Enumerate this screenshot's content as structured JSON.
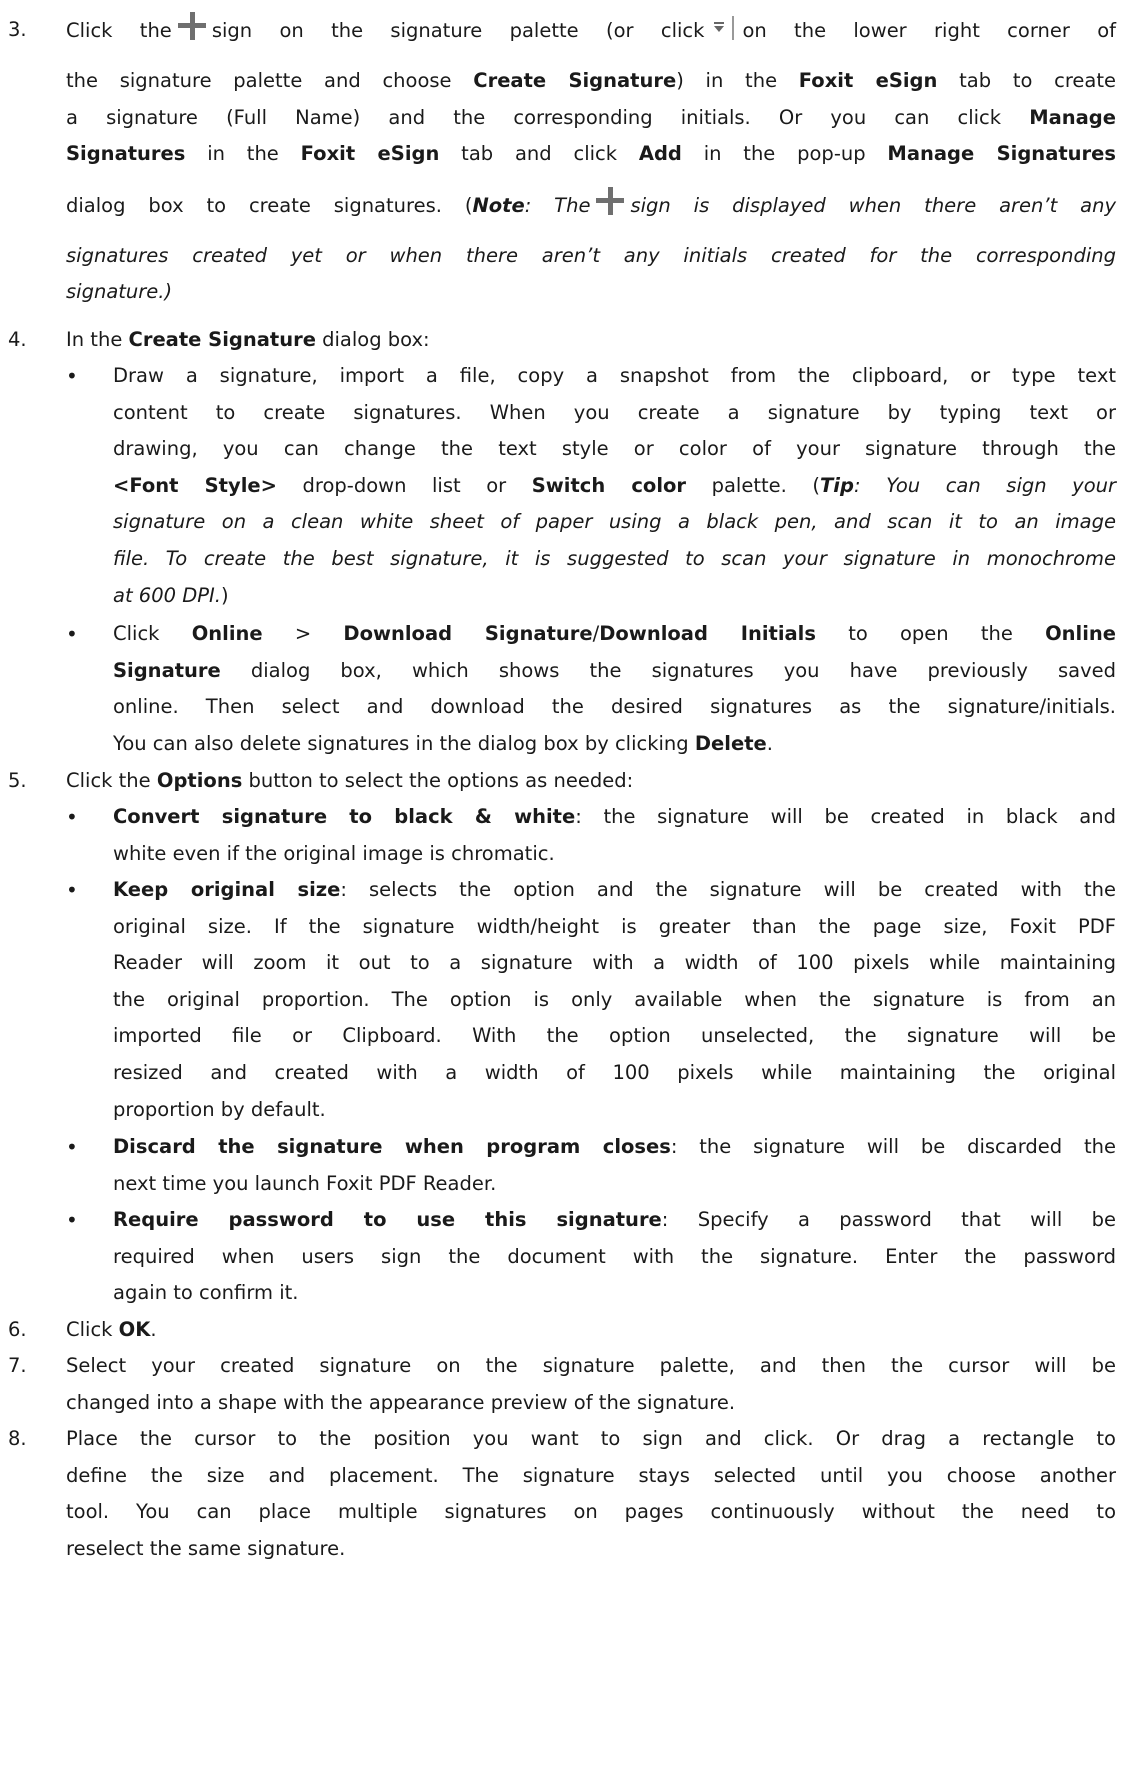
{
  "steps": [
    {
      "num": "3.",
      "l1a": "Click the",
      "l1b": "sign on the signature palette (or click",
      "l1c": "on the lower right corner of",
      "l2a": "the signature palette and choose ",
      "l2b": "Create Signature",
      "l2c": ") in the ",
      "l2d": "Foxit eSign",
      "l2e": " tab to create",
      "l3": "a signature (Full Name) and the corresponding initials. Or you can click ",
      "l3b": "Manage",
      "l4a": "Signatures",
      "l4b": " in the ",
      "l4c": "Foxit eSign",
      "l4d": " tab and click ",
      "l4e": "Add",
      "l4f": " in the pop-up ",
      "l4g": "Manage Signatures",
      "l5a": "dialog box to create signatures. (",
      "l5b": "Note",
      "l5c": ": The",
      "l5d": "sign is displayed when there aren’t any",
      "l6": "signatures created yet or when there aren’t any initials created for the corresponding",
      "l7": "signature.)"
    }
  ],
  "step4": {
    "num": "4.",
    "a": "In the ",
    "b": "Create Signature",
    "c": " dialog box:",
    "bul1": {
      "l1": "Draw a signature, import a file, copy a snapshot from the clipboard, or type text",
      "l2": "content to create signatures. When you create a signature by typing text or",
      "l3": "drawing, you can change the text style or color of your signature through the",
      "l4a": "<Font Style>",
      "l4b": " drop-down list or ",
      "l4c": "Switch color",
      "l4d": " palette. (",
      "l4e": "Tip",
      "l4f": ": You can sign your",
      "l5": "signature on a clean white sheet of paper using a black pen, and scan it to an image",
      "l6": "file. To create the best signature, it is suggested to scan your signature in monochrome",
      "l7a": "at 600 DPI.",
      "l7b": ")"
    },
    "bul2": {
      "l1a": "Click ",
      "l1b": "Online",
      "l1c": " > ",
      "l1d": "Download Signature",
      "l1e": "/",
      "l1f": "Download Initials",
      "l1g": " to open the ",
      "l1h": "Online",
      "l2a": "Signature",
      "l2b": " dialog box, which shows the signatures you have previously saved",
      "l3": "online. Then select and download the desired signatures as the signature/initials.",
      "l4a": "You can also delete signatures in the dialog box by clicking ",
      "l4b": "Delete",
      "l4c": "."
    }
  },
  "step5": {
    "num": "5.",
    "a": "Click the ",
    "b": "Options",
    "c": " button to select the options as needed:",
    "bul1": {
      "l1a": "Convert signature to black & white",
      "l1b": ": the signature will be created in black and",
      "l2": "white even if the original image is chromatic."
    },
    "bul2": {
      "l1a": "Keep original size",
      "l1b": ": selects the option and the signature will be created with the",
      "l2": "original size. If the signature width/height is greater than the page size, Foxit PDF",
      "l3": "Reader will zoom it out to a signature with a width of 100 pixels while maintaining",
      "l4": "the original proportion. The option is only available when the signature is from an",
      "l5": "imported file or Clipboard. With the option unselected, the signature will be",
      "l6": "resized and created with a width of 100 pixels while maintaining the original",
      "l7": "proportion by default."
    },
    "bul3": {
      "l1a": "Discard the signature when program closes",
      "l1b": ": the signature will be discarded the",
      "l2": "next time you launch Foxit PDF Reader."
    },
    "bul4": {
      "l1a": "Require password to use this signature",
      "l1b": ": Specify a password that will be",
      "l2": "required when users sign the document with the signature. Enter the password",
      "l3": "again to confirm it."
    }
  },
  "step6": {
    "num": "6.",
    "a": "Click ",
    "b": "OK",
    "c": "."
  },
  "step7": {
    "num": "7.",
    "l1": "Select your created signature on the signature palette, and then the cursor will be",
    "l2": "changed into a shape with the appearance preview of the signature."
  },
  "step8": {
    "num": "8.",
    "l1": "Place the cursor to the position you want to sign and click. Or drag a rectangle to",
    "l2": "define the size and placement. The signature stays selected until you choose another",
    "l3": "tool. You can place multiple signatures on pages continuously without the need to",
    "l4": "reselect the same signature."
  },
  "bullet_glyph": "•"
}
